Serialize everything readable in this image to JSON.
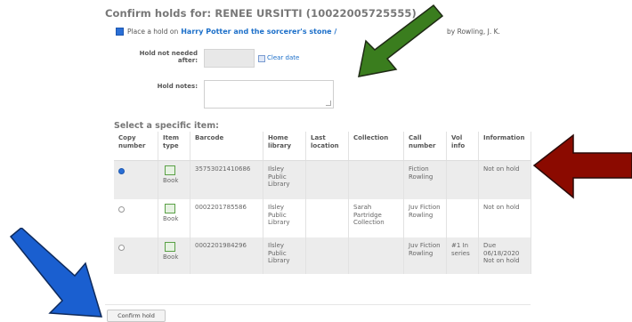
{
  "header": {
    "title": "Confirm holds for: RENEE URSITTI (10022005725555)"
  },
  "hold": {
    "place_hold_label": "Place a hold on",
    "book_title": "Harry Potter and the sorcerer's stone /",
    "author": "by Rowling, J. K."
  },
  "form": {
    "not_needed_label_1": "Hold not needed",
    "not_needed_label_2": "after:",
    "clear_date": "Clear date",
    "notes_label": "Hold notes:"
  },
  "items": {
    "section_title": "Select a specific item:",
    "columns": [
      "Copy number",
      "Item type",
      "Barcode",
      "Home library",
      "Last location",
      "Collection",
      "Call number",
      "Vol info",
      "Information"
    ],
    "rows": [
      {
        "item_type": "Book",
        "barcode": "35753021410686",
        "home_library": "Ilsley Public Library",
        "last_location": "",
        "collection": "",
        "call_number": "Fiction Rowling",
        "vol_info": "",
        "information": "Not on hold",
        "selected": true
      },
      {
        "item_type": "Book",
        "barcode": "0002201785586",
        "home_library": "Ilsley Public Library",
        "last_location": "",
        "collection": "Sarah Partridge Collection",
        "call_number": "Juv Fiction Rowling",
        "vol_info": "",
        "information": "Not on hold",
        "selected": false
      },
      {
        "item_type": "Book",
        "barcode": "0002201984296",
        "home_library": "Ilsley Public Library",
        "last_location": "",
        "collection": "",
        "call_number": "Juv Fiction Rowling",
        "vol_info": "#1 In series",
        "information": "Due 06/18/2020 Not on hold",
        "selected": false
      }
    ]
  },
  "actions": {
    "confirm_label": "Confirm hold"
  },
  "annotations": {
    "green_arrow_color": "#3a7d1e",
    "red_arrow_color": "#8b0a00",
    "blue_arrow_color": "#1a5fd0"
  }
}
